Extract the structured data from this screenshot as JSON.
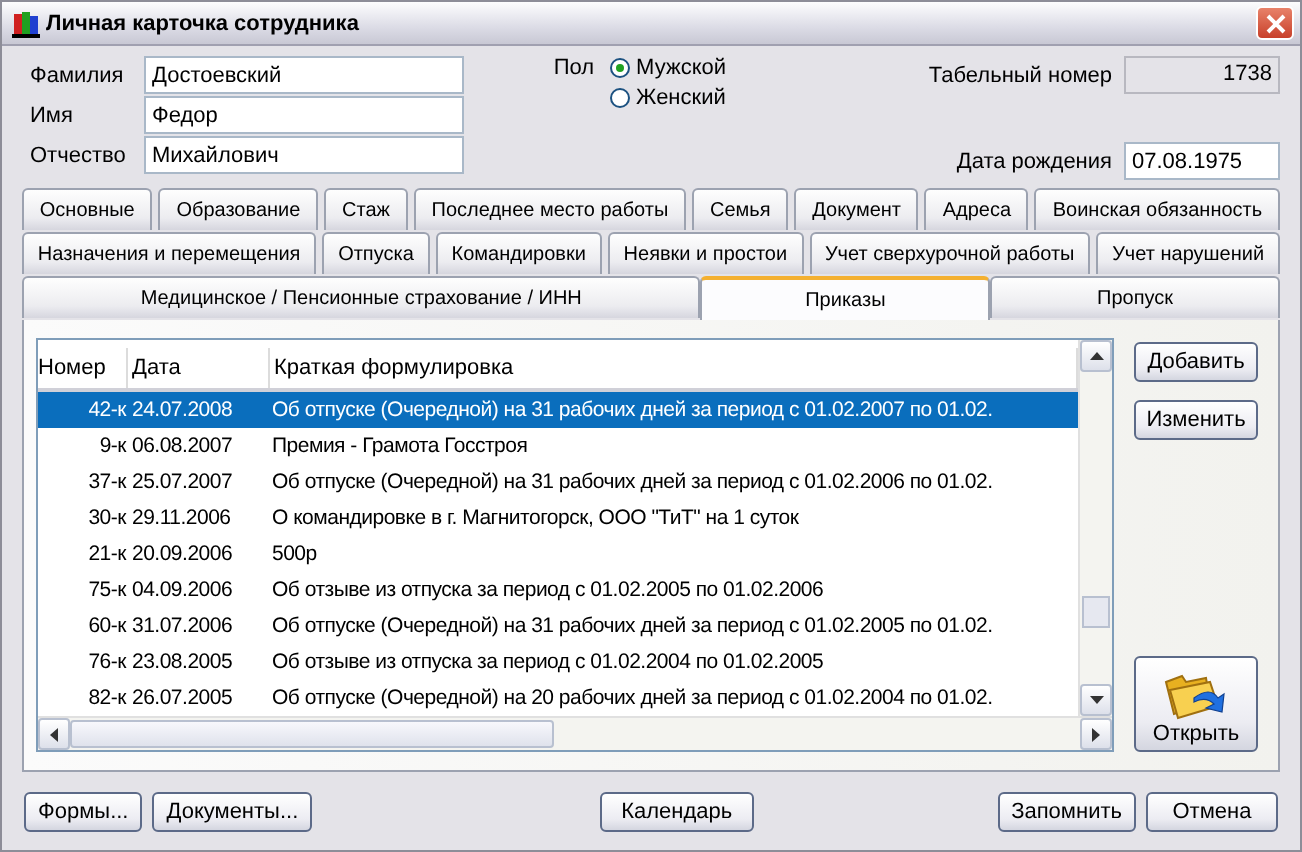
{
  "window": {
    "title": "Личная карточка сотрудника"
  },
  "name_fields": [
    {
      "label": "Фамилия",
      "value": "Достоевский"
    },
    {
      "label": "Имя",
      "value": "Федор"
    },
    {
      "label": "Отчество",
      "value": "Михайлович"
    }
  ],
  "gender": {
    "label": "Пол",
    "options": [
      {
        "label": "Мужской",
        "selected": true
      },
      {
        "label": "Женский",
        "selected": false
      }
    ]
  },
  "personnel_number": {
    "label": "Табельный номер",
    "value": "1738"
  },
  "birth_date": {
    "label": "Дата рождения",
    "value": "07.08.1975"
  },
  "tab_rows": [
    [
      {
        "label": "Основные",
        "selected": false
      },
      {
        "label": "Образование",
        "selected": false
      },
      {
        "label": "Стаж",
        "selected": false
      },
      {
        "label": "Последнее место работы",
        "selected": false
      },
      {
        "label": "Семья",
        "selected": false
      },
      {
        "label": "Документ",
        "selected": false
      },
      {
        "label": "Адреса",
        "selected": false
      },
      {
        "label": "Воинская обязанность",
        "selected": false
      }
    ],
    [
      {
        "label": "Назначения и перемещения",
        "selected": false
      },
      {
        "label": "Отпуска",
        "selected": false
      },
      {
        "label": "Командировки",
        "selected": false
      },
      {
        "label": "Неявки и простои",
        "selected": false
      },
      {
        "label": "Учет сверхурочной работы",
        "selected": false
      },
      {
        "label": "Учет нарушений",
        "selected": false
      }
    ],
    [
      {
        "label": "Медицинское / Пенсионные страхование / ИНН",
        "selected": false
      },
      {
        "label": "Приказы",
        "selected": true
      },
      {
        "label": "Пропуск",
        "selected": false
      }
    ]
  ],
  "table": {
    "columns": [
      "Номер",
      "Дата",
      "Краткая формулировка"
    ],
    "rows": [
      {
        "number": "42-к",
        "date": "24.07.2008",
        "text": "Об отпуске (Очередной) на 31 рабочих дней за период с 01.02.2007 по 01.02.",
        "selected": true
      },
      {
        "number": "9-к",
        "date": "06.08.2007",
        "text": "Премия - Грамота Госстроя",
        "selected": false
      },
      {
        "number": "37-к",
        "date": "25.07.2007",
        "text": "Об отпуске (Очередной) на 31 рабочих дней за период с 01.02.2006 по 01.02.",
        "selected": false
      },
      {
        "number": "30-к",
        "date": "29.11.2006",
        "text": "О командировке в г. Магнитогорск, ООО \"ТиТ\" на 1 суток",
        "selected": false
      },
      {
        "number": "21-к",
        "date": "20.09.2006",
        "text": "500р",
        "selected": false
      },
      {
        "number": "75-к",
        "date": "04.09.2006",
        "text": "Об отзыве из отпуска  за период с 01.02.2005 по 01.02.2006",
        "selected": false
      },
      {
        "number": "60-к",
        "date": "31.07.2006",
        "text": "Об отпуске (Очередной) на 31 рабочих дней за период с 01.02.2005 по 01.02.",
        "selected": false
      },
      {
        "number": "76-к",
        "date": "23.08.2005",
        "text": "Об отзыве из отпуска  за период с 01.02.2004 по 01.02.2005",
        "selected": false
      },
      {
        "number": "82-к",
        "date": "26.07.2005",
        "text": "Об отпуске (Очередной) на 20 рабочих дней за период с 01.02.2004 по 01.02.",
        "selected": false
      }
    ]
  },
  "side_buttons": [
    "Добавить",
    "Изменить"
  ],
  "open_button": "Открыть",
  "bottom_left_buttons": [
    "Формы...",
    "Документы..."
  ],
  "bottom_center_buttons": [
    "Календарь"
  ],
  "bottom_right_buttons": [
    "Запомнить",
    "Отмена"
  ]
}
